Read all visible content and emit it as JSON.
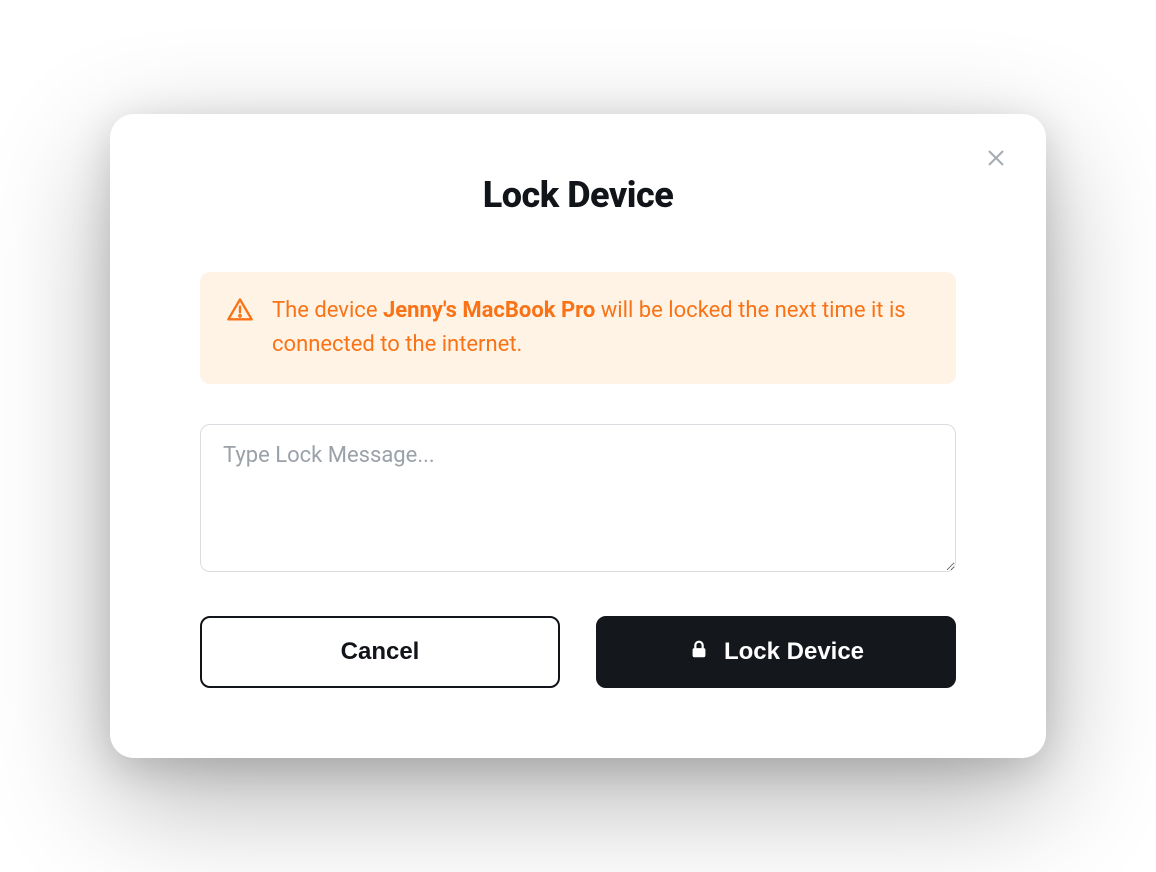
{
  "modal": {
    "title": "Lock Device",
    "alert": {
      "prefix": "The device ",
      "device_name": "Jenny's MacBook Pro",
      "suffix": " will be locked the next time it is connected to the internet."
    },
    "textarea": {
      "placeholder": "Type Lock Message...",
      "value": ""
    },
    "buttons": {
      "cancel": "Cancel",
      "primary": "Lock Device"
    }
  }
}
